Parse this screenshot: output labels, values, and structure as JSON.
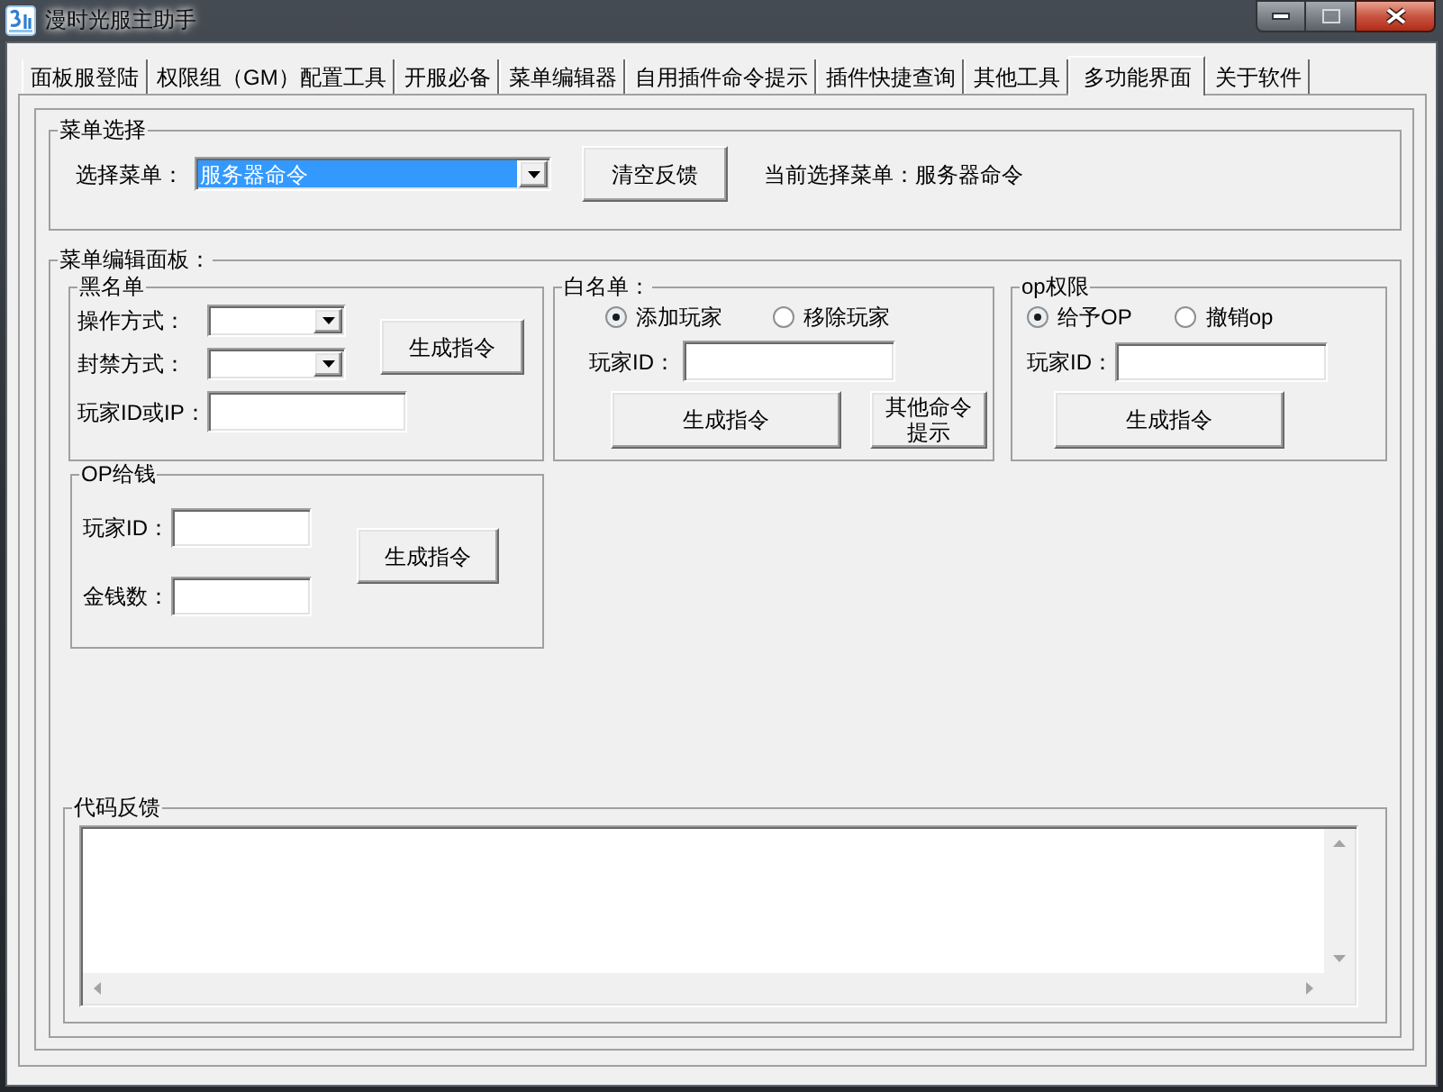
{
  "window": {
    "title": "漫时光服主助手"
  },
  "tabs": [
    {
      "label": "面板服登陆",
      "selected": false
    },
    {
      "label": "权限组（GM）配置工具",
      "selected": false
    },
    {
      "label": "开服必备",
      "selected": false
    },
    {
      "label": "菜单编辑器",
      "selected": false
    },
    {
      "label": "自用插件命令提示",
      "selected": false
    },
    {
      "label": "插件快捷查询",
      "selected": false
    },
    {
      "label": "其他工具",
      "selected": false
    },
    {
      "label": "多功能界面",
      "selected": true
    },
    {
      "label": "关于软件",
      "selected": false
    }
  ],
  "menu_select": {
    "title": "菜单选择",
    "dropdown": {
      "label": "选择菜单：",
      "value": "服务器命令",
      "highlighted": true
    },
    "clear_button": "清空反馈",
    "current_label": "当前选择菜单：",
    "current_value": "服务器命令"
  },
  "menu_editor": {
    "title": "菜单编辑面板：",
    "blacklist": {
      "title": "黑名单",
      "fields": [
        {
          "kind": "dropdown",
          "label": "操作方式："
        },
        {
          "kind": "dropdown",
          "label": "封禁方式："
        },
        {
          "kind": "text",
          "label": "玩家ID或IP："
        }
      ],
      "button": "生成指令"
    },
    "op_money": {
      "title": "OP给钱",
      "fields": [
        {
          "label": "玩家ID："
        },
        {
          "label": "金钱数："
        }
      ],
      "button": "生成指令"
    },
    "whitelist": {
      "title": "白名单：",
      "options": [
        {
          "label": "添加玩家",
          "selected": true
        },
        {
          "label": "移除玩家",
          "selected": false
        }
      ],
      "player_id_label": "玩家ID：",
      "buttons": [
        "生成指令",
        "其他命令提示"
      ]
    },
    "op_permission": {
      "title": "op权限",
      "options": [
        {
          "label": "给予OP",
          "selected": true
        },
        {
          "label": "撤销op",
          "selected": false
        }
      ],
      "player_id_label": "玩家ID：",
      "button": "生成指令"
    },
    "code_feedback": {
      "title": "代码反馈"
    }
  }
}
